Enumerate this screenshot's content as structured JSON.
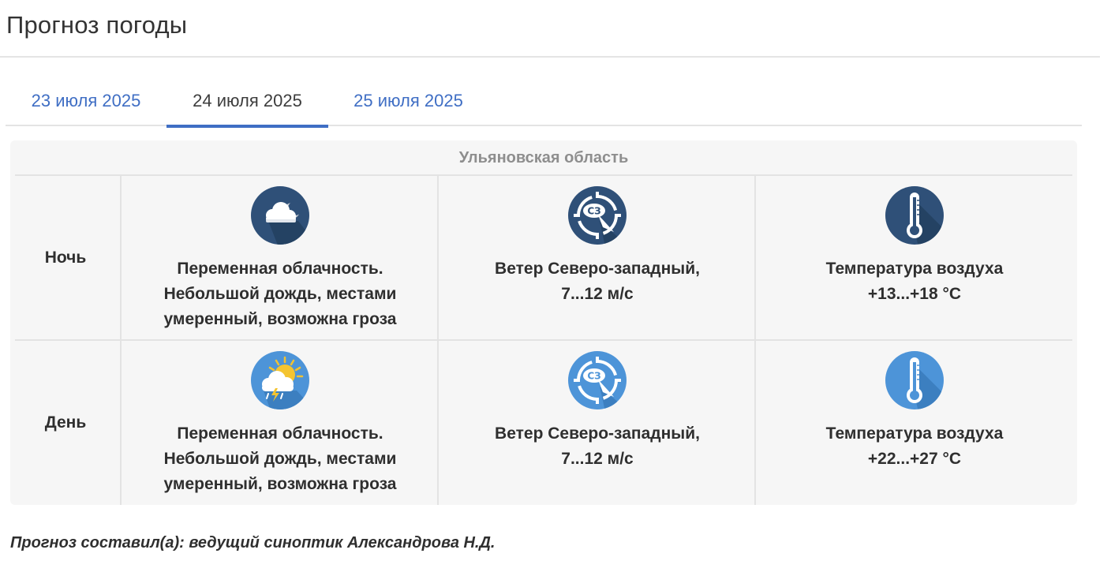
{
  "page": {
    "title": "Прогноз погоды"
  },
  "tabs": [
    {
      "label": "23 июля 2025",
      "active": false
    },
    {
      "label": "24 июля 2025",
      "active": true
    },
    {
      "label": "25 июля 2025",
      "active": false
    }
  ],
  "forecast": {
    "region": "Ульяновская область",
    "rows": [
      {
        "period": "Ночь",
        "weather": {
          "icon": "night-cloud-icon",
          "lines": [
            "Переменная облачность.",
            "Небольшой дождь, местами",
            "умеренный, возможна гроза"
          ]
        },
        "wind": {
          "icon": "wind-northwest-icon",
          "badge": "СЗ",
          "lines": [
            "Ветер Северо-западный,",
            "7...12 м/с"
          ]
        },
        "temp": {
          "icon": "thermometer-icon",
          "lines": [
            "Температура воздуха",
            "+13...+18 °C"
          ]
        }
      },
      {
        "period": "День",
        "weather": {
          "icon": "sun-cloud-thunderstorm-icon",
          "lines": [
            "Переменная облачность.",
            "Небольшой дождь, местами",
            "умеренный, возможна гроза"
          ]
        },
        "wind": {
          "icon": "wind-northwest-icon",
          "badge": "СЗ",
          "lines": [
            "Ветер Северо-западный,",
            "7...12 м/с"
          ]
        },
        "temp": {
          "icon": "thermometer-icon",
          "lines": [
            "Температура воздуха",
            "+22...+27 °C"
          ]
        }
      }
    ]
  },
  "colors": {
    "night_icon_bg": "#2f5078",
    "day_icon_bg": "#4d94d8",
    "tab_link": "#3f6ec4",
    "cell_bg": "#f6f6f6"
  },
  "author": "Прогноз составил(а): ведущий синоптик Александрова Н.Д."
}
